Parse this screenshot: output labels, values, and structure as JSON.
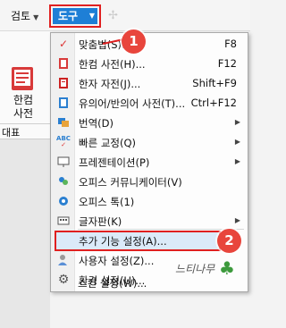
{
  "menubar": {
    "review_tab": "검토",
    "tools_tab": "도구"
  },
  "left_panel": {
    "hanja_label_line1": "한컴",
    "hanja_label_line2": "사전",
    "group_label": "대표"
  },
  "dropdown": {
    "items": [
      {
        "label": "맞춤법(S)...",
        "shortcut": "F8",
        "icon": "spellcheck-icon",
        "submenu": false
      },
      {
        "label": "한컴 사전(H)...",
        "shortcut": "F12",
        "icon": "dictionary-icon",
        "submenu": false
      },
      {
        "label": "한자 자전(J)...",
        "shortcut": "Shift+F9",
        "icon": "hanja-dictionary-icon",
        "submenu": false
      },
      {
        "label": "유의어/반의어 사전(T)...",
        "shortcut": "Ctrl+F12",
        "icon": "thesaurus-icon",
        "submenu": false
      },
      {
        "label": "번역(D)",
        "shortcut": "",
        "icon": "translate-icon",
        "submenu": true
      },
      {
        "label": "빠른 교정(Q)",
        "shortcut": "",
        "icon": "quick-correct-icon",
        "submenu": true
      },
      {
        "label": "프레젠테이션(P)",
        "shortcut": "",
        "icon": "presentation-icon",
        "submenu": true
      },
      {
        "label": "오피스 커뮤니케이터(V)",
        "shortcut": "",
        "icon": "communicator-icon",
        "submenu": false
      },
      {
        "label": "오피스 톡(1)",
        "shortcut": "",
        "icon": "office-talk-icon",
        "submenu": false
      },
      {
        "label": "글자판(K)",
        "shortcut": "",
        "icon": "keyboard-layout-icon",
        "submenu": true
      },
      {
        "label": "추가 기능 설정(A)...",
        "shortcut": "",
        "icon": "",
        "submenu": false
      },
      {
        "label": "사용자 설정(Z)...",
        "shortcut": "",
        "icon": "user-settings-icon",
        "submenu": false
      },
      {
        "label": "환경 설정(U)...",
        "shortcut": "",
        "icon": "environment-settings-icon",
        "submenu": false
      },
      {
        "label": "스킨 설정(W)...",
        "shortcut": "",
        "icon": "",
        "submenu": false
      }
    ]
  },
  "callouts": {
    "step1": "1",
    "step2": "2"
  },
  "watermark": "느티나무",
  "colors": {
    "accent": "#1e7fd6",
    "highlight_border": "#e02020",
    "badge": "#e8453c"
  }
}
